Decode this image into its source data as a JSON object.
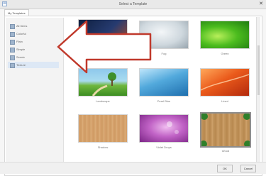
{
  "window": {
    "title": "Select a Template",
    "close_glyph": "✕"
  },
  "tabs": [
    {
      "label": "My Templates"
    }
  ],
  "sidebar": {
    "items": [
      {
        "label": "All Items"
      },
      {
        "label": "Colorful"
      },
      {
        "label": "Plain"
      },
      {
        "label": "Simple"
      },
      {
        "label": "Scenic"
      },
      {
        "label": "Texture"
      }
    ]
  },
  "templates": [
    {
      "label": ""
    },
    {
      "label": "Fog"
    },
    {
      "label": "Green"
    },
    {
      "label": "Landscape"
    },
    {
      "label": "Pearl Blue"
    },
    {
      "label": "Lined"
    },
    {
      "label": "Shadow"
    },
    {
      "label": "Violet Drops"
    },
    {
      "label": "Wood"
    }
  ],
  "footer": {
    "ok_label": "OK",
    "cancel_label": "Cancel"
  },
  "icons": {
    "arrow": "left-arrow-annotation",
    "app": "template-icon",
    "close": "close-icon"
  },
  "colors": {
    "annotation_arrow": "#c0392b",
    "selection_border": "#8d8d8d"
  }
}
